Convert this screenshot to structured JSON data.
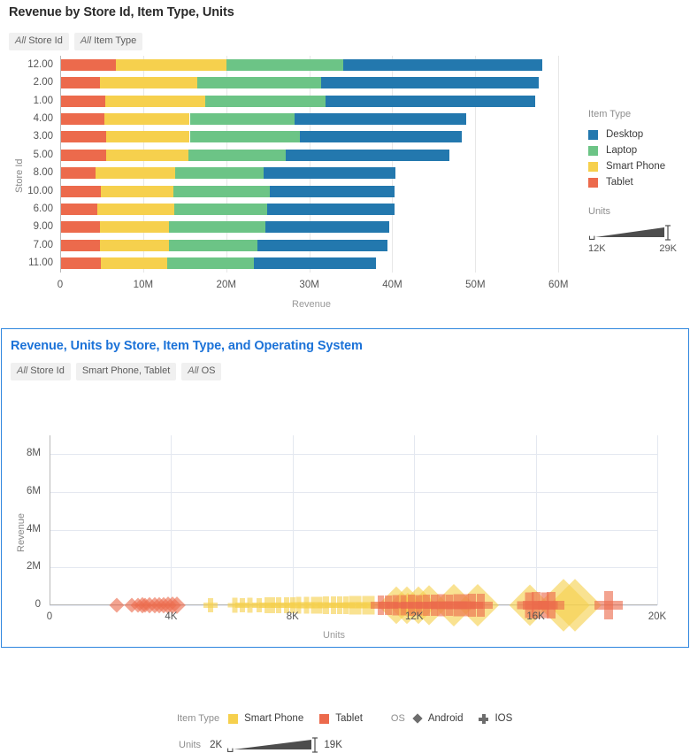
{
  "panel_bar": {
    "title": "Revenue by Store Id, Item Type, Units",
    "chips": [
      {
        "prefix": "All",
        "label": " Store Id"
      },
      {
        "prefix": "All",
        "label": " Item Type"
      }
    ],
    "legend": {
      "title": "Item Type",
      "items": [
        {
          "label": "Desktop",
          "color": "#2378ae"
        },
        {
          "label": "Laptop",
          "color": "#6cc486"
        },
        {
          "label": "Smart Phone",
          "color": "#f6d04d"
        },
        {
          "label": "Tablet",
          "color": "#ec6a4c"
        }
      ]
    },
    "size_legend": {
      "title": "Units",
      "min": "12K",
      "max": "29K"
    }
  },
  "panel_scatter": {
    "title": "Revenue, Units by Store, Item Type, and Operating System",
    "chips": [
      {
        "prefix": "All",
        "label": " Store Id"
      },
      {
        "prefix": "",
        "label": "Smart Phone, Tablet"
      },
      {
        "prefix": "All",
        "label": " OS"
      }
    ],
    "legend": {
      "item_type_title": "Item Type",
      "item_types": [
        {
          "label": "Smart Phone",
          "color": "#f6d04d"
        },
        {
          "label": "Tablet",
          "color": "#ec6a4c"
        }
      ],
      "os_title": "OS",
      "os": [
        {
          "label": "Android",
          "marker": "diamond-icon"
        },
        {
          "label": "IOS",
          "marker": "plus-icon"
        }
      ]
    },
    "size_legend": {
      "title": "Units",
      "min": "2K",
      "max": "19K"
    }
  },
  "chart_data": [
    {
      "type": "bar",
      "orientation": "horizontal",
      "stacked": true,
      "title": "Revenue by Store Id, Item Type, Units",
      "xlabel": "Revenue",
      "ylabel": "Store Id",
      "xlim": [
        0,
        62000000
      ],
      "xticks": [
        "0",
        "10M",
        "20M",
        "30M",
        "40M",
        "50M",
        "60M"
      ],
      "xtick_values": [
        0,
        10000000,
        20000000,
        30000000,
        40000000,
        50000000,
        60000000
      ],
      "grid": true,
      "categories": [
        "12.00",
        "2.00",
        "1.00",
        "4.00",
        "3.00",
        "5.00",
        "8.00",
        "10.00",
        "6.00",
        "9.00",
        "7.00",
        "11.00"
      ],
      "series": [
        {
          "name": "Tablet",
          "color": "#ec6a4c",
          "values": [
            6600000,
            4700000,
            5300000,
            5200000,
            5400000,
            5400000,
            4200000,
            4800000,
            4400000,
            4700000,
            4700000,
            4800000
          ]
        },
        {
          "name": "Smart Phone",
          "color": "#f6d04d",
          "values": [
            13300000,
            11700000,
            12100000,
            10300000,
            10100000,
            9900000,
            9500000,
            8700000,
            9200000,
            8300000,
            8300000,
            8000000
          ]
        },
        {
          "name": "Laptop",
          "color": "#6cc486",
          "values": [
            14100000,
            14900000,
            14400000,
            12600000,
            13300000,
            11800000,
            10700000,
            11600000,
            11200000,
            11600000,
            10600000,
            10400000
          ]
        },
        {
          "name": "Desktop",
          "color": "#2378ae",
          "values": [
            24000000,
            26200000,
            25300000,
            20700000,
            19500000,
            19700000,
            15900000,
            15100000,
            15400000,
            14900000,
            15700000,
            14700000
          ]
        }
      ],
      "totals": [
        58000000,
        57500000,
        57100000,
        48800000,
        48300000,
        46800000,
        40300000,
        40200000,
        40200000,
        39500000,
        39300000,
        37900000
      ]
    },
    {
      "type": "scatter",
      "title": "Revenue, Units by Store, Item Type, and Operating System",
      "xlabel": "Units",
      "ylabel": "Revenue",
      "xlim": [
        0,
        20000
      ],
      "ylim": [
        0,
        9000000
      ],
      "xticks": [
        "0",
        "4K",
        "8K",
        "12K",
        "16K",
        "20K"
      ],
      "xtick_values": [
        0,
        4000,
        8000,
        12000,
        16000,
        20000
      ],
      "yticks": [
        "0",
        "2M",
        "4M",
        "6M",
        "8M"
      ],
      "ytick_values": [
        0,
        2000000,
        4000000,
        6000000,
        8000000
      ],
      "grid": true,
      "size_encodes": "Units",
      "series": [
        {
          "name": "Smart Phone / IOS",
          "color": "#f6d04d",
          "marker": "plus",
          "points": [
            [
              5300,
              1650,
              16
            ],
            [
              6100,
              1970,
              17
            ],
            [
              6350,
              1880,
              16
            ],
            [
              6600,
              2060,
              17
            ],
            [
              6900,
              1800,
              16
            ],
            [
              7150,
              2200,
              18
            ],
            [
              7350,
              2380,
              18
            ],
            [
              7550,
              2260,
              18
            ],
            [
              7800,
              2440,
              18
            ],
            [
              8000,
              2300,
              18
            ],
            [
              8200,
              2600,
              19
            ],
            [
              8450,
              2480,
              19
            ],
            [
              8700,
              2900,
              19
            ],
            [
              8900,
              2700,
              19
            ],
            [
              9100,
              3050,
              20
            ],
            [
              9350,
              2880,
              20
            ],
            [
              9550,
              3250,
              20
            ],
            [
              9750,
              3050,
              20
            ],
            [
              9950,
              3400,
              21
            ],
            [
              10150,
              3250,
              21
            ],
            [
              10400,
              3550,
              21
            ],
            [
              10600,
              3300,
              21
            ]
          ]
        },
        {
          "name": "Smart Phone / Android",
          "color": "#f6d04d",
          "marker": "diamond",
          "points": [
            [
              11400,
              5700,
              30
            ],
            [
              11750,
              5950,
              30
            ],
            [
              12150,
              6100,
              30
            ],
            [
              12500,
              6400,
              32
            ],
            [
              13300,
              6300,
              34
            ],
            [
              14100,
              7000,
              34
            ],
            [
              15800,
              6500,
              33
            ],
            [
              16900,
              8500,
              42
            ],
            [
              17300,
              8200,
              42
            ],
            [
              11800,
              4600,
              20
            ]
          ]
        },
        {
          "name": "Tablet / IOS",
          "color": "#ec6a4c",
          "marker": "plus",
          "points": [
            [
              10900,
              4100,
              22
            ],
            [
              11150,
              4000,
              22
            ],
            [
              11400,
              4350,
              23
            ],
            [
              11650,
              4200,
              23
            ],
            [
              11900,
              4500,
              24
            ],
            [
              12150,
              4300,
              23
            ],
            [
              12400,
              4600,
              24
            ],
            [
              12650,
              4450,
              24
            ],
            [
              12900,
              4750,
              25
            ],
            [
              13150,
              4550,
              24
            ],
            [
              13400,
              4800,
              25
            ],
            [
              13650,
              4650,
              25
            ],
            [
              13900,
              4950,
              26
            ],
            [
              14200,
              4800,
              26
            ],
            [
              15800,
              5600,
              29
            ],
            [
              16000,
              5900,
              30
            ],
            [
              16300,
              5700,
              29
            ],
            [
              16500,
              6100,
              30
            ],
            [
              18400,
              6800,
              32
            ]
          ]
        },
        {
          "name": "Tablet / Android",
          "color": "#ec6a4c",
          "marker": "diamond",
          "points": [
            [
              2200,
              300,
              12
            ],
            [
              2700,
              350,
              12
            ],
            [
              2900,
              330,
              12
            ],
            [
              3050,
              420,
              13
            ],
            [
              3150,
              300,
              12
            ],
            [
              3300,
              450,
              13
            ],
            [
              3450,
              380,
              13
            ],
            [
              3600,
              500,
              13
            ],
            [
              3750,
              420,
              13
            ],
            [
              3900,
              560,
              14
            ],
            [
              4050,
              500,
              14
            ],
            [
              4200,
              600,
              14
            ]
          ]
        }
      ]
    }
  ]
}
